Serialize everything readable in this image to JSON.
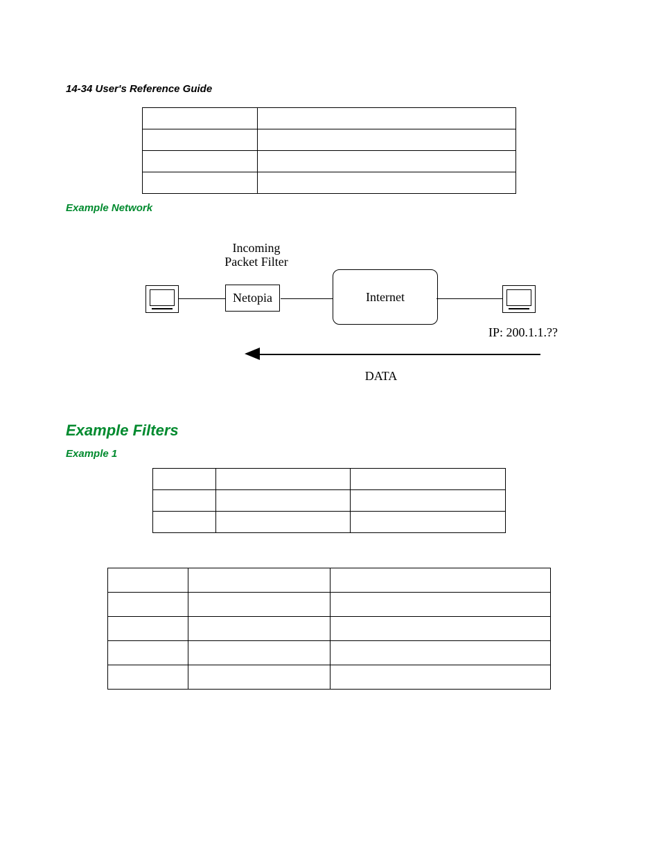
{
  "header": "14-34  User's Reference Guide",
  "sections": {
    "example_network": "Example Network",
    "example_filters": "Example Filters",
    "example1": "Example 1"
  },
  "diagram": {
    "incoming_label": "Incoming\nPacket Filter",
    "netopia": "Netopia",
    "internet": "Internet",
    "ip_label": "IP: 200.1.1.??",
    "data_label": "DATA"
  },
  "table1": {
    "rows": 4,
    "cols": 2
  },
  "table2": {
    "rows": 3,
    "cols": 3
  },
  "table3": {
    "rows": 5,
    "cols": 3
  }
}
